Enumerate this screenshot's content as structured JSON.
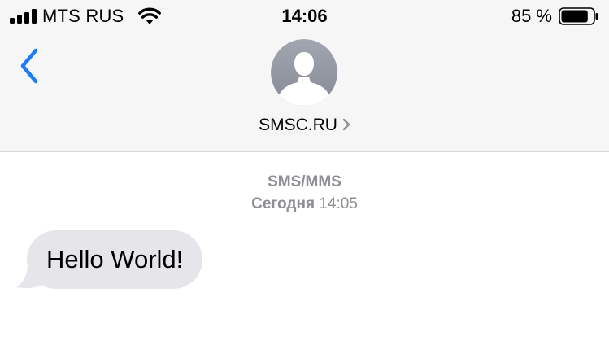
{
  "status_bar": {
    "carrier": "MTS RUS",
    "time": "14:06",
    "battery_percent": "85 %",
    "battery_level": 0.85,
    "signal_icon": "signal-bars-icon",
    "wifi_icon": "wifi-icon",
    "battery_icon": "battery-icon"
  },
  "nav": {
    "back_icon": "chevron-left-icon",
    "avatar_icon": "person-silhouette-icon",
    "contact_name": "SMSC.RU",
    "disclosure_icon": "chevron-right-icon"
  },
  "conversation": {
    "service": "SMS/MMS",
    "day": "Сегодня",
    "time": "14:05",
    "messages": [
      {
        "direction": "incoming",
        "text": "Hello World!"
      }
    ]
  },
  "colors": {
    "accent": "#1c7ef6",
    "header_bg": "#f6f6f6",
    "incoming_bubble": "#e5e5ea",
    "meta_text": "#8e8e93"
  }
}
